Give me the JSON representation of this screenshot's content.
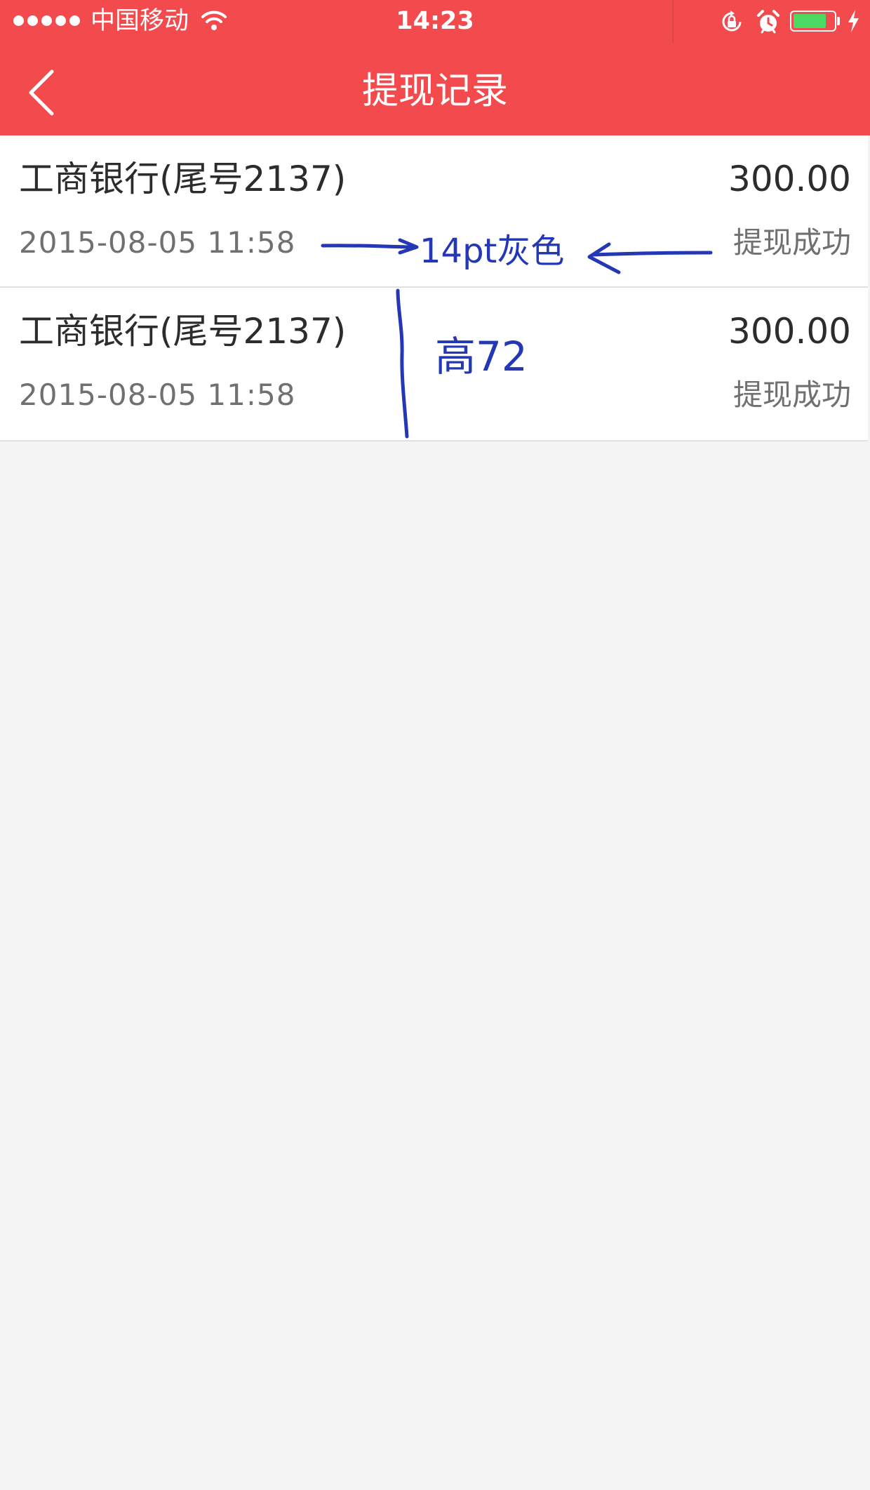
{
  "status_bar": {
    "carrier": "中国移动",
    "time": "14:23",
    "battery_level": 0.83,
    "icons": [
      "signal-icon",
      "wifi-icon",
      "rotation-lock-icon",
      "alarm-icon",
      "battery-icon",
      "charging-icon"
    ]
  },
  "header": {
    "title": "提现记录",
    "back_icon": "chevron-left-icon"
  },
  "records": [
    {
      "bank": "工商银行(尾号2137)",
      "amount": "300.00",
      "time": "2015-08-05 11:58",
      "status": "提现成功"
    },
    {
      "bank": "工商银行(尾号2137)",
      "amount": "300.00",
      "time": "2015-08-05 11:58",
      "status": "提现成功"
    }
  ],
  "annotations": {
    "font_note": "14pt灰色",
    "height_note": "高72"
  },
  "colors": {
    "header_bg": "#f24a4d",
    "page_bg": "#f4f4f4",
    "primary_text": "#2c2c2c",
    "secondary_text": "#707070",
    "annotation": "#2437b4",
    "battery_fill": "#4cd964"
  }
}
